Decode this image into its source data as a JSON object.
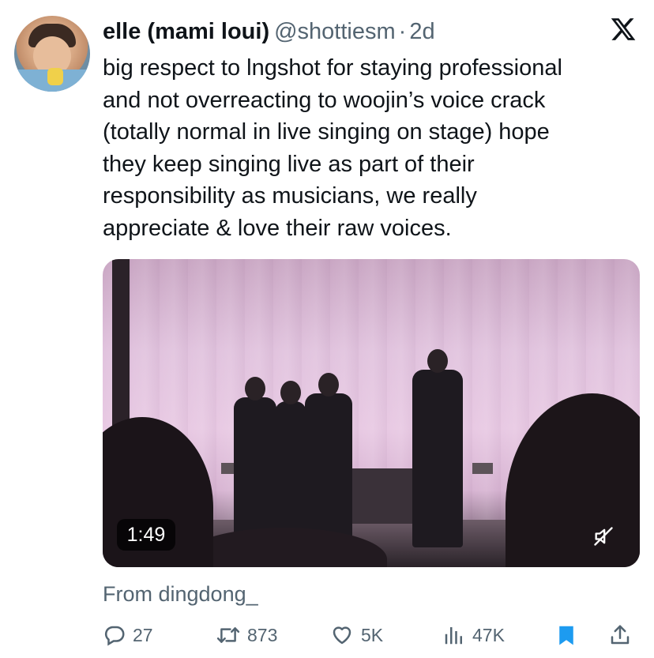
{
  "tweet": {
    "display_name": "elle (mami loui)",
    "handle": "@shottiesm",
    "separator": "·",
    "time": "2d",
    "text_lines": [
      "big respect to lngshot for staying professional",
      "and not overreacting to woojin’s voice crack",
      "(totally normal in live singing on stage) hope",
      "they keep singing live as part of their",
      "responsibility as musicians, we really",
      "appreciate & love their raw voices."
    ],
    "media": {
      "duration": "1:49",
      "muted": true
    },
    "source": "From dingdong_"
  },
  "actions": {
    "replies": "27",
    "reposts": "873",
    "likes": "5K",
    "views": "47K"
  },
  "icons": {
    "platform_logo": "x-logo-icon",
    "reply": "reply-icon",
    "repost": "repost-icon",
    "like": "heart-icon",
    "views": "views-icon",
    "bookmark": "bookmark-icon",
    "share": "share-icon",
    "mute": "muted-speaker-icon"
  },
  "colors": {
    "text": "#0f1419",
    "secondary": "#536471",
    "bookmark_active": "#1d9bf0",
    "background": "#ffffff"
  }
}
